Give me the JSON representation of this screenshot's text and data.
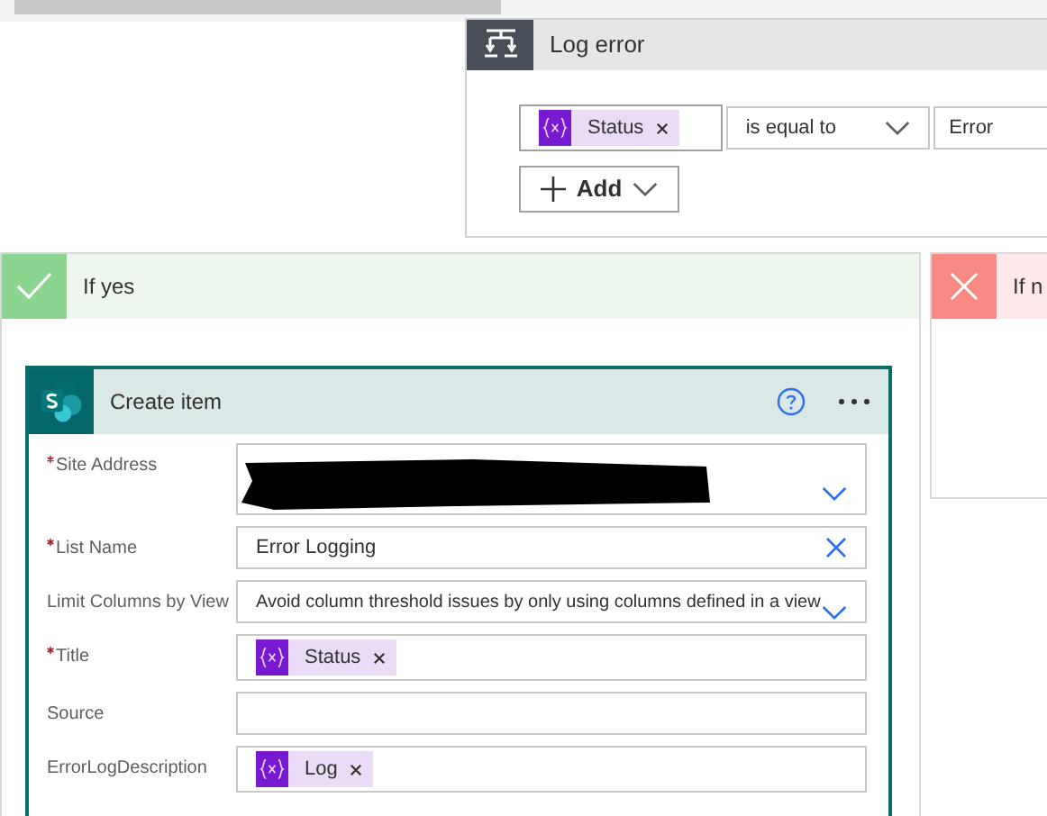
{
  "condition": {
    "title": "Log error",
    "token": {
      "kind": "expression",
      "label": "Status"
    },
    "operator": "is equal to",
    "value": "Error",
    "add_button": "Add"
  },
  "branches": [
    {
      "kind": "yes",
      "title": "If yes"
    },
    {
      "kind": "no",
      "title": "If n"
    }
  ],
  "action": {
    "title": "Create item",
    "fields": [
      {
        "kind": "dropdown",
        "label": "Site Address",
        "required": true,
        "redacted": true
      },
      {
        "kind": "clearable",
        "label": "List Name",
        "required": true,
        "value": "Error Logging"
      },
      {
        "kind": "dropdown",
        "label": "Limit Columns by View",
        "required": false,
        "value": "Avoid column threshold issues by only using columns defined in a view"
      },
      {
        "kind": "token",
        "label": "Title",
        "required": true,
        "token": "Status"
      },
      {
        "kind": "text",
        "label": "Source",
        "required": false
      },
      {
        "kind": "token",
        "label": "ErrorLogDescription",
        "required": false,
        "token": "Log"
      }
    ]
  }
}
